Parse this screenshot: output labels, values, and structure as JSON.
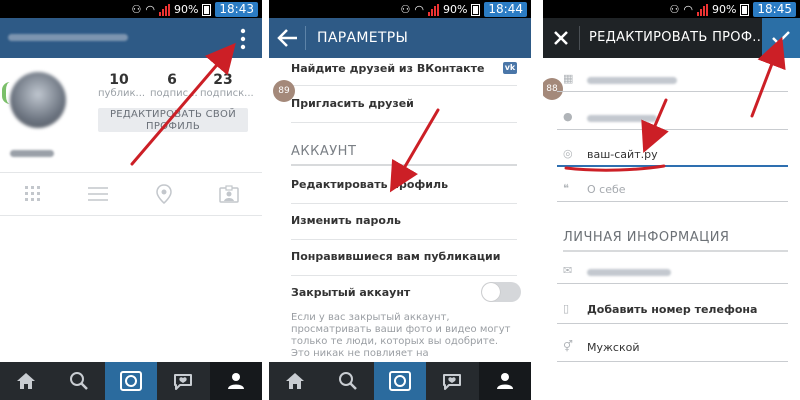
{
  "status_bars": [
    {
      "battery": "90%",
      "time": "18:43"
    },
    {
      "battery": "90%",
      "time": "18:44"
    },
    {
      "battery": "90%",
      "time": "18:45"
    }
  ],
  "profile_screen": {
    "stats": [
      {
        "value": "10",
        "label": "публик..."
      },
      {
        "value": "6",
        "label": "подпис..."
      },
      {
        "value": "23",
        "label": "подписк..."
      }
    ],
    "edit_button_label": "РЕДАКТИРОВАТЬ СВОЙ ПРОФИЛЬ",
    "view_icons": [
      "grid-icon",
      "list-icon",
      "location-pin-icon",
      "tagged-icon"
    ]
  },
  "settings_screen": {
    "title": "ПАРАМЕТРЫ",
    "items_top": [
      {
        "label": "Найдите друзей из ВКонтакте",
        "icon": "vk-icon"
      },
      {
        "label": "Пригласить друзей"
      }
    ],
    "vk_glyph": "vk",
    "badge": "89",
    "section_account": "АККАУНТ",
    "account_items": [
      "Редактировать профиль",
      "Изменить пароль",
      "Понравившиеся вам публикации",
      "Закрытый аккаунт"
    ],
    "private_account_on": false,
    "private_description": "Если у вас закрытый аккаунт, просматривать ваши фото и видео могут только те люди, которых вы одобрите. Это никак не повлияет на"
  },
  "edit_profile_screen": {
    "title": "РЕДАКТИРОВАТЬ ПРОФ...",
    "badge": "88",
    "website_value": "ваш-сайт.ру",
    "bio_placeholder": "О себе",
    "section_personal": "ЛИЧНАЯ ИНФОРМАЦИЯ",
    "add_phone_label": "Добавить номер телефона",
    "gender_value": "Мужской"
  },
  "tab_icons": [
    "home-icon",
    "search-icon",
    "camera-icon",
    "activity-icon",
    "profile-icon"
  ],
  "colors": {
    "header": "#2e5a86",
    "tabbar": "#262a2e",
    "tab_active": "#2b6b9e",
    "annotation_arrow": "#cc1f26"
  }
}
